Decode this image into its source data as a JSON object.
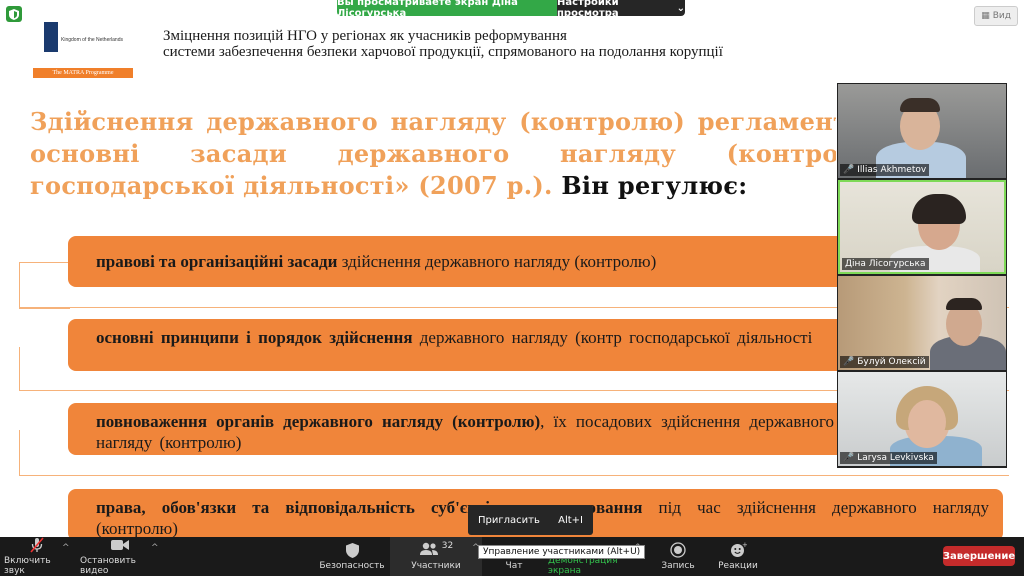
{
  "zoom": {
    "share_banner": "Вы просматриваете экран Діна Лісогурська",
    "view_options": "Настройки просмотра",
    "view_button": "Вид",
    "toolbar": {
      "mute": "Включить звук",
      "video": "Остановить видео",
      "security": "Безопасность",
      "participants": "Участники",
      "participants_count": "32",
      "chat": "Чат",
      "share": "Демонстрация экрана",
      "record": "Запись",
      "reactions": "Реакции",
      "end": "Завершение"
    },
    "invite_menu": {
      "label": "Пригласить",
      "shortcut": "Alt+I"
    },
    "participants_tooltip": "Управление участниками (Alt+U)",
    "participants_list": [
      {
        "name": "Illias Akhmetov"
      },
      {
        "name": "Діна Лісогурська"
      },
      {
        "name": "Булуй Олексій"
      },
      {
        "name": "Larysa Levkivska"
      }
    ]
  },
  "slide": {
    "logo_country": "Kingdom of the Netherlands",
    "logo_programme": "The MATRA Programme",
    "header_line1": "Зміцнення позицій НГО у регіонах як учасників реформування",
    "header_line2": "системи забезпечення безпеки харчової продукції, спрямованого на подолання корупції",
    "title_line1": "Здійснення державного нагляду (контролю) регламенту",
    "title_line2": "основні засади державного нагляду (контролю)",
    "title_line3": "господарської діяльності» (2007 р.).",
    "title_black": " Він регулює:",
    "items": [
      {
        "bold": "правові та організаційні засади",
        "rest": " здійснення державного нагляду (контролю)"
      },
      {
        "bold": "основні принципи і порядок здійснення",
        "rest": " державного нагляду (контр господарської діяльності"
      },
      {
        "bold": "повноваження органів державного нагляду (контролю)",
        "rest": ", їх посадових здійснення державного нагляду (контролю)"
      },
      {
        "bold": "права, обов'язки та відповідальність суб'єктів господарювання",
        "rest": " під час здійснення державного нагляду (контролю)"
      }
    ]
  },
  "colors": {
    "accent_orange": "#f0853a",
    "title_orange": "#f0a15a",
    "share_green": "#33a847",
    "end_red": "#c42b2b"
  }
}
